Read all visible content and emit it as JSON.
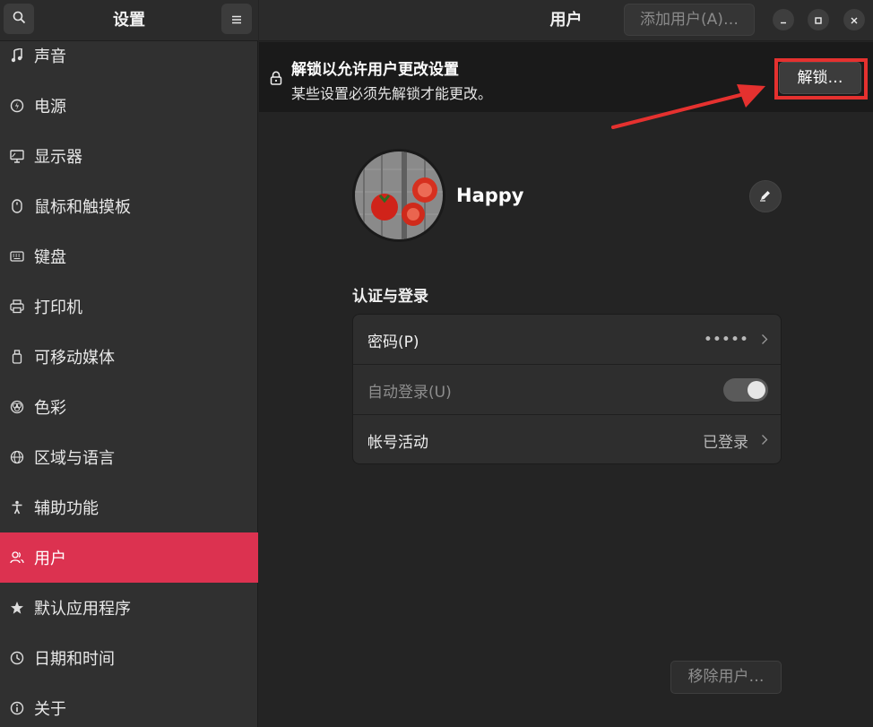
{
  "sidebar": {
    "title": "设置",
    "items": [
      {
        "label": "声音",
        "icon": "music-note-icon"
      },
      {
        "label": "电源",
        "icon": "power-icon"
      },
      {
        "label": "显示器",
        "icon": "display-icon"
      },
      {
        "label": "鼠标和触摸板",
        "icon": "mouse-icon"
      },
      {
        "label": "键盘",
        "icon": "keyboard-icon"
      },
      {
        "label": "打印机",
        "icon": "printer-icon"
      },
      {
        "label": "可移动媒体",
        "icon": "removable-media-icon"
      },
      {
        "label": "色彩",
        "icon": "color-icon"
      },
      {
        "label": "区域与语言",
        "icon": "globe-icon"
      },
      {
        "label": "辅助功能",
        "icon": "accessibility-icon"
      },
      {
        "label": "用户",
        "icon": "users-icon",
        "active": true
      },
      {
        "label": "默认应用程序",
        "icon": "star-icon"
      },
      {
        "label": "日期和时间",
        "icon": "clock-icon"
      },
      {
        "label": "关于",
        "icon": "info-icon"
      }
    ]
  },
  "header": {
    "title": "用户",
    "add_user_label": "添加用户(A)…"
  },
  "banner": {
    "title": "解锁以允许用户更改设置",
    "subtitle": "某些设置必须先解锁才能更改。",
    "unlock_label": "解锁…"
  },
  "profile": {
    "username": "Happy"
  },
  "auth": {
    "section_title": "认证与登录",
    "rows": [
      {
        "label": "密码(P)",
        "value": "•••••"
      },
      {
        "label": "自动登录(U)",
        "toggle": true
      },
      {
        "label": "帐号活动",
        "value": "已登录"
      }
    ]
  },
  "remove_user_label": "移除用户…",
  "colors": {
    "accent": "#dc3250",
    "highlight": "#e5312f"
  }
}
